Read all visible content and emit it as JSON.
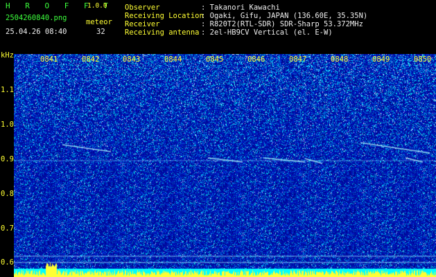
{
  "header": {
    "app_name": "H R O F F T",
    "version": "1.0.0",
    "filename": "2504260840.png",
    "datetime": "25.04.26 08:40",
    "meteor_label": "meteor",
    "meteor_count": "32"
  },
  "info": {
    "observer_label": "Observer",
    "observer_value": ": Takanori Kawachi",
    "location_label": "Receiving Location",
    "location_value": ": Ogaki, Gifu, JAPAN (136.60E, 35.35N)",
    "receiver_label": "Receiver",
    "receiver_value": ": R820T2(RTL-SDR) SDR-Sharp 53.372MHz",
    "antenna_label": "Receiving antenna",
    "antenna_value": ": 2el-HB9CV Vertical (el. E-W)"
  },
  "axis": {
    "unit": "kHz",
    "y_ticks": [
      "1.1",
      "1.0",
      "0.9",
      "0.8",
      "0.7",
      "0.6"
    ],
    "x_ticks": [
      "0841",
      "0842",
      "0843",
      "0844",
      "0845",
      "0846",
      "0847",
      "0848",
      "0849",
      "0850"
    ]
  },
  "colors": {
    "header_green": "#3cff3c",
    "header_white": "#f0f0f0",
    "axis_yellow": "#ffff33",
    "spectrogram_base": "#00008a",
    "signal_cyan": "#00ffff"
  }
}
